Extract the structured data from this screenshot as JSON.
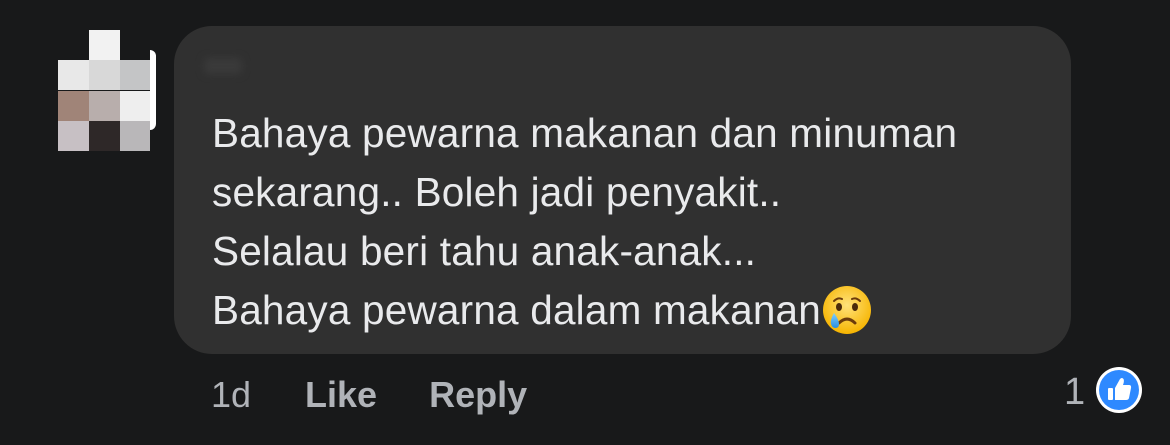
{
  "comment": {
    "lines": [
      "Bahaya pewarna makanan dan minuman",
      "sekarang..  Boleh jadi penyakit..",
      "Selalau beri tahu anak-anak...",
      "Bahaya pewarna dalam makanan"
    ],
    "emoji": "crying-face"
  },
  "actions": {
    "time": "1d",
    "like_label": "Like",
    "reply_label": "Reply"
  },
  "reactions": {
    "count": "1",
    "icon": "like-thumb-icon",
    "color": "#2e89ff"
  },
  "colors": {
    "background": "#18191a",
    "bubble": "#303030",
    "text": "#e9eaec",
    "secondary_text": "#b0b3b8"
  }
}
